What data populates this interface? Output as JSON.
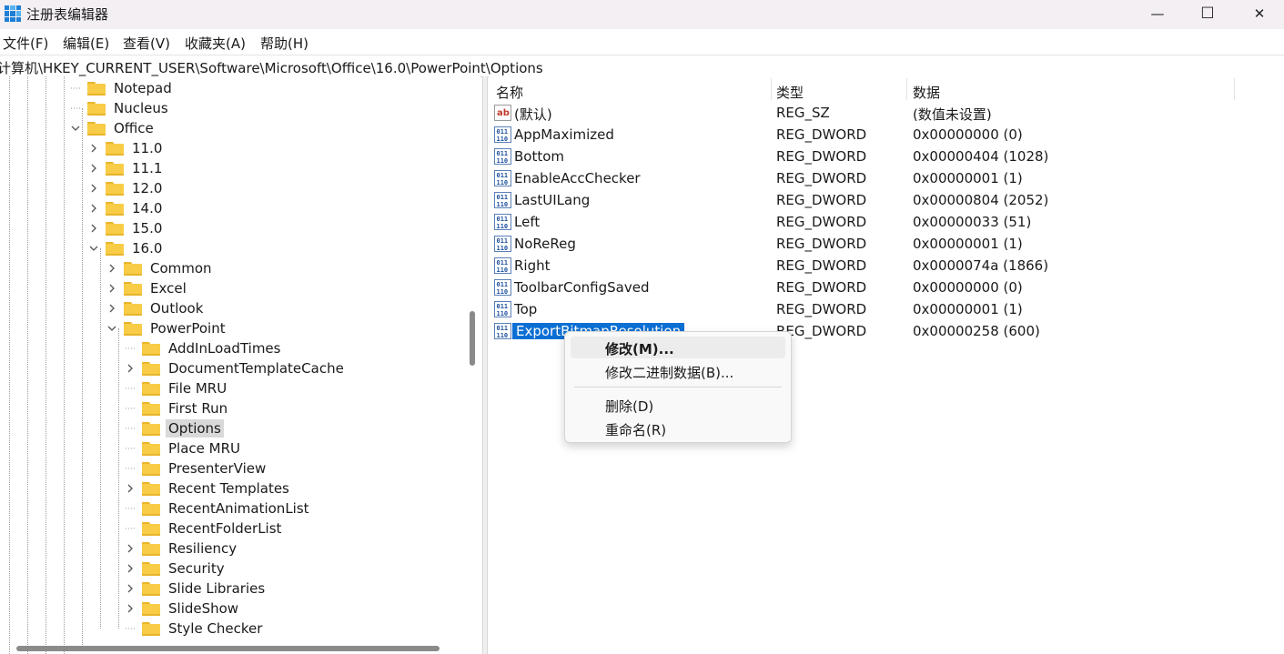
{
  "window": {
    "title": "注册表编辑器",
    "minimize_glyph": "—",
    "maximize_glyph": "☐",
    "close_glyph": "✕"
  },
  "menu": [
    "文件(F)",
    "编辑(E)",
    "查看(V)",
    "收藏夹(A)",
    "帮助(H)"
  ],
  "address": "计算机\\HKEY_CURRENT_USER\\Software\\Microsoft\\Office\\16.0\\PowerPoint\\Options",
  "tree": {
    "items": [
      {
        "label": "Notepad",
        "expand": "none"
      },
      {
        "label": "Nucleus",
        "expand": "none"
      },
      {
        "label": "Office",
        "expand": "expanded"
      },
      {
        "label": "11.0",
        "expand": "collapsed"
      },
      {
        "label": "11.1",
        "expand": "collapsed"
      },
      {
        "label": "12.0",
        "expand": "collapsed"
      },
      {
        "label": "14.0",
        "expand": "collapsed"
      },
      {
        "label": "15.0",
        "expand": "collapsed"
      },
      {
        "label": "16.0",
        "expand": "expanded"
      },
      {
        "label": "Common",
        "expand": "collapsed"
      },
      {
        "label": "Excel",
        "expand": "collapsed"
      },
      {
        "label": "Outlook",
        "expand": "collapsed"
      },
      {
        "label": "PowerPoint",
        "expand": "expanded"
      },
      {
        "label": "AddInLoadTimes",
        "expand": "none"
      },
      {
        "label": "DocumentTemplateCache",
        "expand": "collapsed"
      },
      {
        "label": "File MRU",
        "expand": "none"
      },
      {
        "label": "First Run",
        "expand": "none"
      },
      {
        "label": "Options",
        "expand": "none",
        "selected": true
      },
      {
        "label": "Place MRU",
        "expand": "none"
      },
      {
        "label": "PresenterView",
        "expand": "none"
      },
      {
        "label": "Recent Templates",
        "expand": "collapsed"
      },
      {
        "label": "RecentAnimationList",
        "expand": "none"
      },
      {
        "label": "RecentFolderList",
        "expand": "none"
      },
      {
        "label": "Resiliency",
        "expand": "collapsed"
      },
      {
        "label": "Security",
        "expand": "collapsed"
      },
      {
        "label": "Slide Libraries",
        "expand": "collapsed"
      },
      {
        "label": "SlideShow",
        "expand": "collapsed"
      },
      {
        "label": "Style Checker",
        "expand": "none"
      }
    ]
  },
  "list": {
    "headers": {
      "name": "名称",
      "type": "类型",
      "data": "数据"
    },
    "rows": [
      {
        "icon": "string-value-icon",
        "name": "(默认)",
        "type": "REG_SZ",
        "data": "(数值未设置)"
      },
      {
        "icon": "binary-value-icon",
        "name": "AppMaximized",
        "type": "REG_DWORD",
        "data": "0x00000000 (0)"
      },
      {
        "icon": "binary-value-icon",
        "name": "Bottom",
        "type": "REG_DWORD",
        "data": "0x00000404 (1028)"
      },
      {
        "icon": "binary-value-icon",
        "name": "EnableAccChecker",
        "type": "REG_DWORD",
        "data": "0x00000001 (1)"
      },
      {
        "icon": "binary-value-icon",
        "name": "LastUILang",
        "type": "REG_DWORD",
        "data": "0x00000804 (2052)"
      },
      {
        "icon": "binary-value-icon",
        "name": "Left",
        "type": "REG_DWORD",
        "data": "0x00000033 (51)"
      },
      {
        "icon": "binary-value-icon",
        "name": "NoReReg",
        "type": "REG_DWORD",
        "data": "0x00000001 (1)"
      },
      {
        "icon": "binary-value-icon",
        "name": "Right",
        "type": "REG_DWORD",
        "data": "0x0000074a (1866)"
      },
      {
        "icon": "binary-value-icon",
        "name": "ToolbarConfigSaved",
        "type": "REG_DWORD",
        "data": "0x00000000 (0)"
      },
      {
        "icon": "binary-value-icon",
        "name": "Top",
        "type": "REG_DWORD",
        "data": "0x00000001 (1)"
      },
      {
        "icon": "binary-value-icon",
        "name": "ExportBitmapResolution",
        "type": "REG_DWORD",
        "data": "0x00000258 (600)",
        "selected": true
      }
    ]
  },
  "context_menu": {
    "items": [
      "修改(M)...",
      "修改二进制数据(B)...",
      "删除(D)",
      "重命名(R)"
    ]
  },
  "colors": {
    "selection": "#0b6fd4",
    "folder": "#f8cc47",
    "tree_selected": "#d9d9d9"
  }
}
